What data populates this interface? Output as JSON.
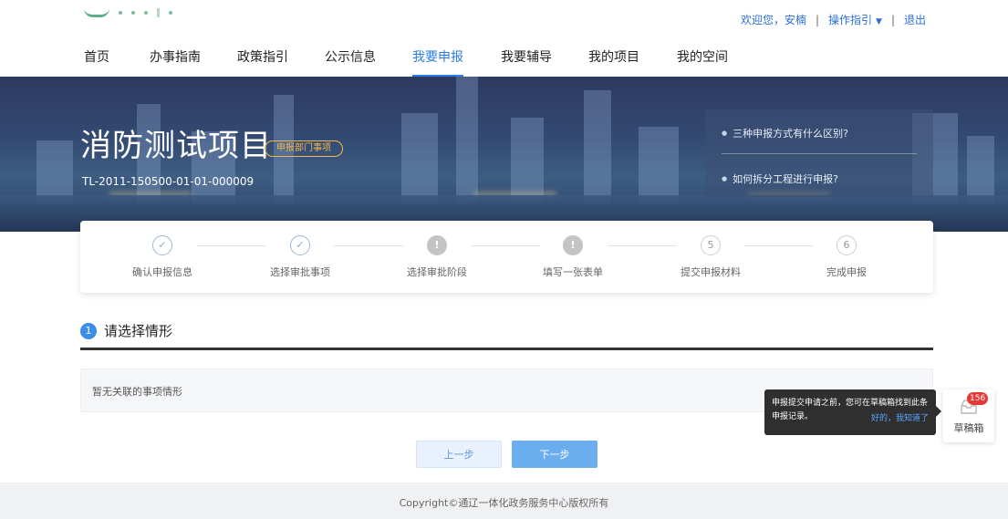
{
  "user_bar": {
    "welcome": "欢迎您，安楠",
    "guide": "操作指引",
    "logout": "退出"
  },
  "nav": {
    "items": [
      {
        "label": "首页"
      },
      {
        "label": "办事指南"
      },
      {
        "label": "政策指引"
      },
      {
        "label": "公示信息"
      },
      {
        "label": "我要申报"
      },
      {
        "label": "我要辅导"
      },
      {
        "label": "我的项目"
      },
      {
        "label": "我的空间"
      }
    ],
    "active": "我要申报"
  },
  "banner": {
    "title": "消防测试项目",
    "tag": "申报部门事项",
    "code": "TL-2011-150500-01-01-000009",
    "faq": [
      {
        "label": "三种申报方式有什么区别?"
      },
      {
        "label": "如何拆分工程进行申报?"
      }
    ]
  },
  "steps": [
    {
      "label": "确认申报信息",
      "icon": "check-icon",
      "state": "done"
    },
    {
      "label": "选择审批事项",
      "icon": "check-icon",
      "state": "done"
    },
    {
      "label": "选择审批阶段",
      "icon": "exclamation-icon",
      "state": "warn"
    },
    {
      "label": "填写一张表单",
      "icon": "exclamation-icon",
      "state": "warn"
    },
    {
      "label": "提交申报材料",
      "number": "5",
      "state": "todo"
    },
    {
      "label": "完成申报",
      "number": "6",
      "state": "todo"
    }
  ],
  "section": {
    "number": "1",
    "title": "请选择情形",
    "empty_text": "暂无关联的事项情形"
  },
  "buttons": {
    "prev": "上一步",
    "next": "下一步"
  },
  "tooltip": {
    "text": "申报提交申请之前，您可在草稿箱找到此条申报记录。",
    "link": "好的，我知道了"
  },
  "draft": {
    "badge": "156",
    "label": "草稿箱",
    "icon": "inbox-icon"
  },
  "footer": {
    "copyright": "Copyright©通辽一体化政务服务中心版权所有"
  },
  "colors": {
    "accent": "#2b7de0",
    "tag": "#f2b84b",
    "badge": "#e53935"
  }
}
